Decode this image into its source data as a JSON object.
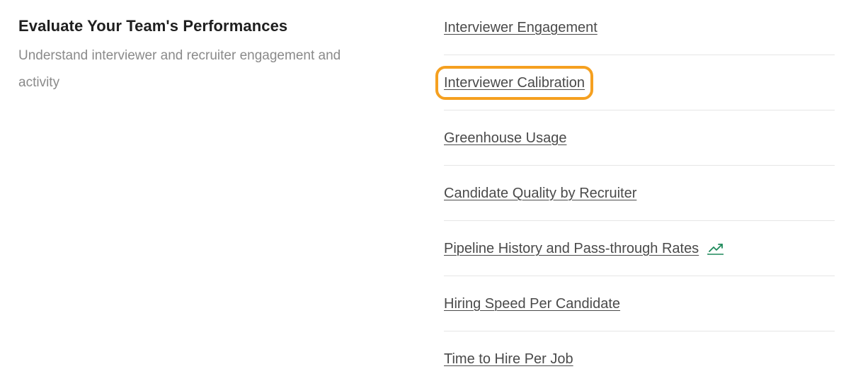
{
  "section": {
    "title": "Evaluate Your Team's Performances",
    "subtitle": "Understand interviewer and recruiter engagement and activity"
  },
  "reports": [
    {
      "label": "Interviewer Engagement",
      "highlighted": false,
      "icon": null
    },
    {
      "label": "Interviewer Calibration",
      "highlighted": true,
      "icon": null
    },
    {
      "label": "Greenhouse Usage",
      "highlighted": false,
      "icon": null
    },
    {
      "label": "Candidate Quality by Recruiter",
      "highlighted": false,
      "icon": null
    },
    {
      "label": "Pipeline History and Pass-through Rates",
      "highlighted": false,
      "icon": "trend-chart-icon"
    },
    {
      "label": "Hiring Speed Per Candidate",
      "highlighted": false,
      "icon": null
    },
    {
      "label": "Time to Hire Per Job",
      "highlighted": false,
      "icon": null
    }
  ],
  "colors": {
    "highlight": "#f5a020",
    "trend_icon": "#1f8a5b",
    "link": "#4a4a4a",
    "subtitle": "#8a8a8a"
  }
}
